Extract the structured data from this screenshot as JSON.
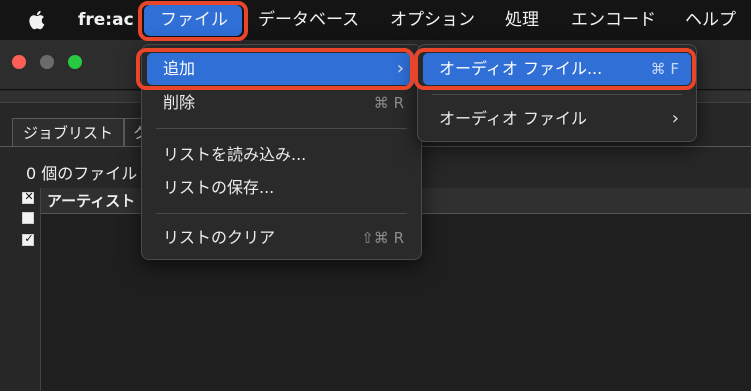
{
  "menubar": {
    "app_name": "fre:ac",
    "items": [
      "ファイル",
      "データベース",
      "オプション",
      "処理",
      "エンコード",
      "ヘルプ"
    ]
  },
  "window": {
    "tabs": [
      "ジョブリスト",
      "ク"
    ],
    "file_count": "0 個のファイル",
    "list_header": {
      "artist": "アーティスト"
    },
    "checkbox_marks": [
      "✕",
      "",
      "✓"
    ]
  },
  "file_menu": {
    "add": "追加",
    "delete": "削除",
    "delete_shortcut": "⌘ R",
    "load_list": "リストを読み込み...",
    "save_list": "リストの保存...",
    "clear_list": "リストのクリア",
    "clear_shortcut": "⇧⌘ R"
  },
  "add_submenu": {
    "audio_file_dots": "オーディオ ファイル...",
    "audio_file_dots_shortcut": "⌘ F",
    "audio_file": "オーディオ ファイル"
  },
  "colors": {
    "highlight_blue": "#2f6fd6",
    "annotation_red": "#e8452a"
  },
  "icons": {
    "apple": "apple-logo-icon",
    "chevron": "chevron-right-icon"
  }
}
